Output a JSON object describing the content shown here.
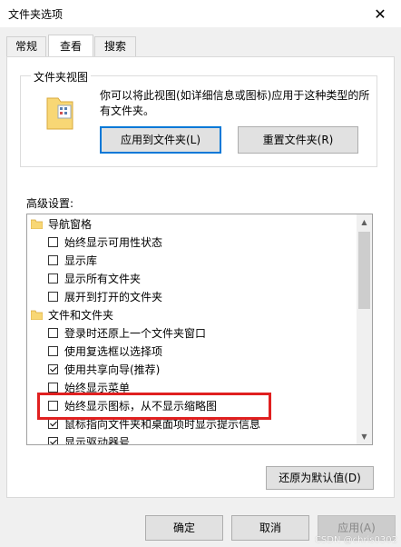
{
  "window": {
    "title": "文件夹选项",
    "close_icon": "close-icon"
  },
  "tabs": [
    {
      "label": "常规",
      "active": false
    },
    {
      "label": "查看",
      "active": true
    },
    {
      "label": "搜索",
      "active": false
    }
  ],
  "folder_views": {
    "group_title": "文件夹视图",
    "description": "你可以将此视图(如详细信息或图标)应用于这种类型的所有文件夹。",
    "apply_button": "应用到文件夹(L)",
    "reset_button": "重置文件夹(R)"
  },
  "advanced": {
    "label": "高级设置:",
    "items": [
      {
        "type": "folder",
        "label": "导航窗格"
      },
      {
        "type": "check",
        "label": "始终显示可用性状态",
        "checked": false
      },
      {
        "type": "check",
        "label": "显示库",
        "checked": false
      },
      {
        "type": "check",
        "label": "显示所有文件夹",
        "checked": false
      },
      {
        "type": "check",
        "label": "展开到打开的文件夹",
        "checked": false
      },
      {
        "type": "folder",
        "label": "文件和文件夹"
      },
      {
        "type": "check",
        "label": "登录时还原上一个文件夹窗口",
        "checked": false
      },
      {
        "type": "check",
        "label": "使用复选框以选择项",
        "checked": false
      },
      {
        "type": "check",
        "label": "使用共享向导(推荐)",
        "checked": true
      },
      {
        "type": "check",
        "label": "始终显示菜单",
        "checked": false
      },
      {
        "type": "check",
        "label": "始终显示图标，从不显示缩略图",
        "checked": false
      },
      {
        "type": "check",
        "label": "鼠标指向文件夹和桌面项时显示提示信息",
        "checked": true
      },
      {
        "type": "check",
        "label": "显示驱动器号",
        "checked": true
      }
    ]
  },
  "restore_button": "还原为默认值(D)",
  "footer": {
    "ok": "确定",
    "cancel": "取消",
    "apply": "应用(A)"
  },
  "watermark": "CSDN @chris0302",
  "colors": {
    "highlight": "#e02020",
    "focus": "#0078d7"
  }
}
